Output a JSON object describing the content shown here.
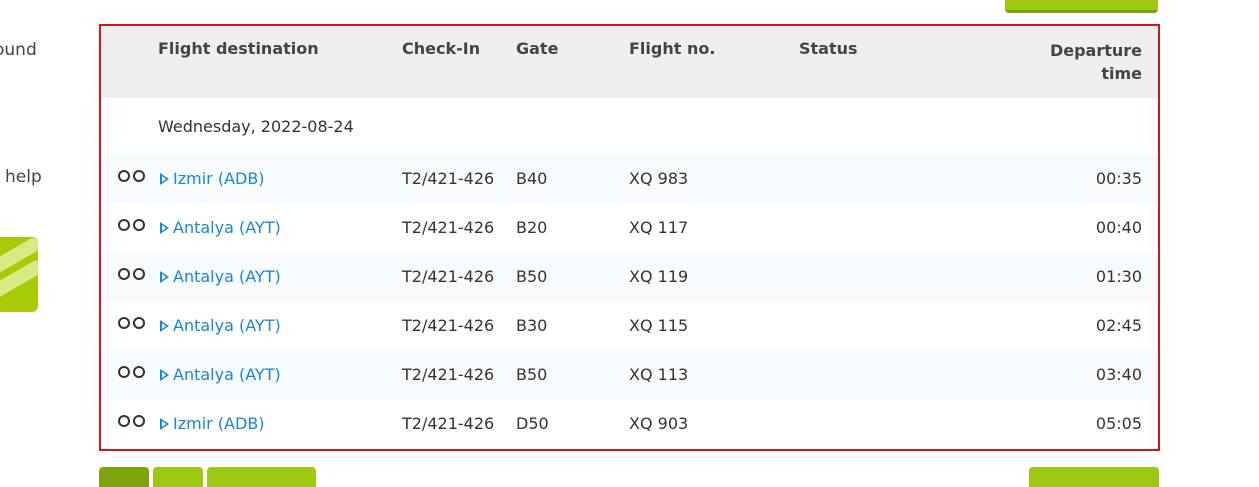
{
  "side": {
    "found_text": "ound",
    "help_text": "help"
  },
  "table": {
    "headers": {
      "destination": "Flight destination",
      "checkin": "Check-In",
      "gate": "Gate",
      "flight_no": "Flight no.",
      "status": "Status",
      "departure_line1": "Departure",
      "departure_line2": "time"
    },
    "date_label": "Wednesday, 2022-08-24",
    "rows": [
      {
        "destination": "Izmir (ADB)",
        "checkin": "T2/421-426",
        "gate": "B40",
        "flight_no": "XQ 983",
        "status": "",
        "departure": "00:35"
      },
      {
        "destination": "Antalya (AYT)",
        "checkin": "T2/421-426",
        "gate": "B20",
        "flight_no": "XQ 117",
        "status": "",
        "departure": "00:40"
      },
      {
        "destination": "Antalya (AYT)",
        "checkin": "T2/421-426",
        "gate": "B50",
        "flight_no": "XQ 119",
        "status": "",
        "departure": "01:30"
      },
      {
        "destination": "Antalya (AYT)",
        "checkin": "T2/421-426",
        "gate": "B30",
        "flight_no": "XQ 115",
        "status": "",
        "departure": "02:45"
      },
      {
        "destination": "Antalya (AYT)",
        "checkin": "T2/421-426",
        "gate": "B50",
        "flight_no": "XQ 113",
        "status": "",
        "departure": "03:40"
      },
      {
        "destination": "Izmir (ADB)",
        "checkin": "T2/421-426",
        "gate": "D50",
        "flight_no": "XQ 903",
        "status": "",
        "departure": "05:05"
      }
    ]
  },
  "colors": {
    "accent_green": "#9ec814",
    "highlight_border": "#d6121f",
    "link_blue": "#1a86d6"
  }
}
